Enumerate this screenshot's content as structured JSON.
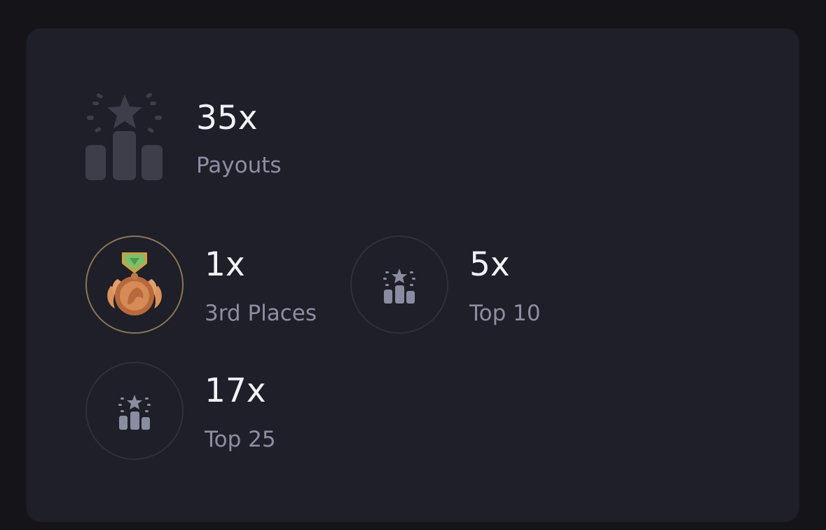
{
  "summary": {
    "value": "35x",
    "label": "Payouts",
    "icon": "podium-icon"
  },
  "stats": [
    {
      "value": "1x",
      "label": "3rd Places",
      "icon": "bronze-medal-icon"
    },
    {
      "value": "5x",
      "label": "Top 10",
      "icon": "podium-icon"
    },
    {
      "value": "17x",
      "label": "Top 25",
      "icon": "podium-icon"
    }
  ],
  "colors": {
    "background": "#141419",
    "card": "#1e1f28",
    "text_primary": "#f2f2f6",
    "text_secondary": "#8d8ea3",
    "badge_ring": "#2f303b",
    "badge_ring_gold": "#8a7556",
    "icon_muted": "#4a4b59",
    "icon_small": "#8a8ca0"
  }
}
